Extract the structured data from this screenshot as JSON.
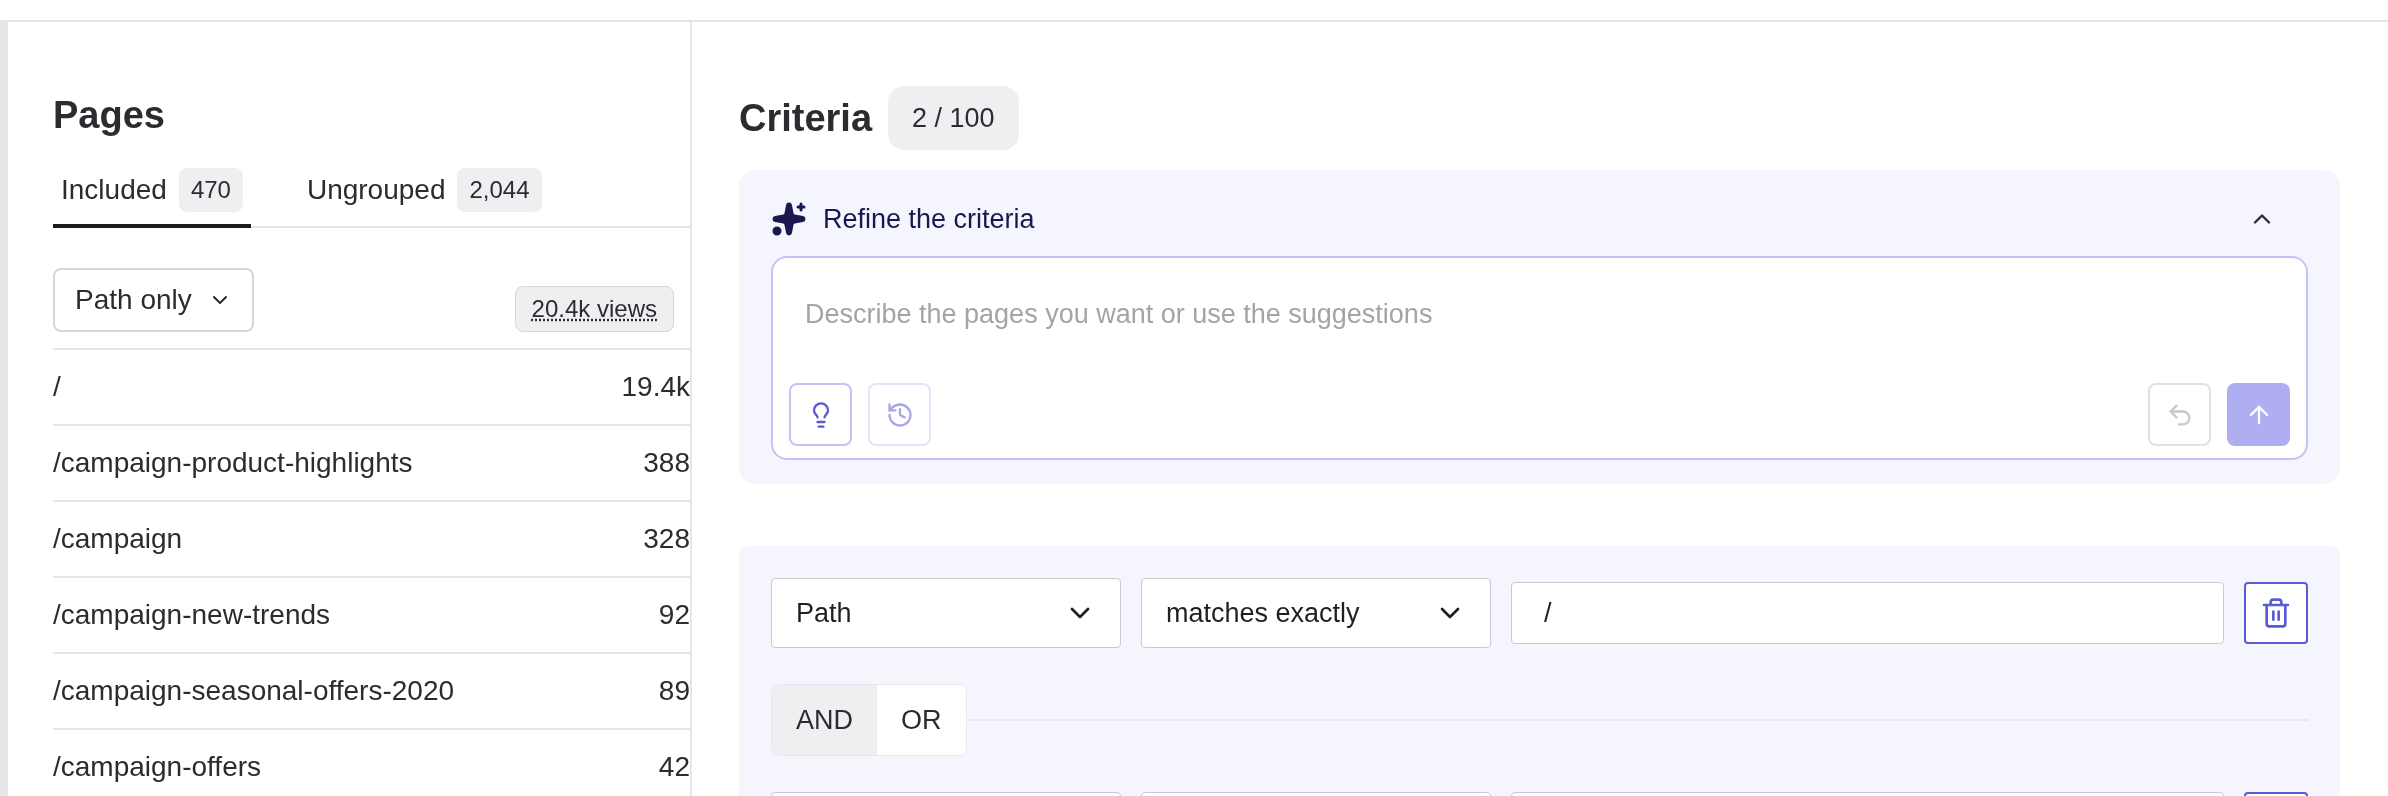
{
  "pages": {
    "title": "Pages",
    "tabs": [
      {
        "label": "Included",
        "count": "470",
        "selected": true
      },
      {
        "label": "Ungrouped",
        "count": "2,044",
        "selected": false
      }
    ],
    "filter": "Path only",
    "views": "20.4k views",
    "rows": [
      {
        "path": "/",
        "views": "19.4k"
      },
      {
        "path": "/campaign-product-highlights",
        "views": "388"
      },
      {
        "path": "/campaign",
        "views": "328"
      },
      {
        "path": "/campaign-new-trends",
        "views": "92"
      },
      {
        "path": "/campaign-seasonal-offers-2020",
        "views": "89"
      },
      {
        "path": "/campaign-offers",
        "views": "42"
      }
    ]
  },
  "criteria": {
    "title": "Criteria",
    "count": "2 / 100",
    "refine": {
      "title": "Refine the criteria",
      "expanded": true,
      "placeholder": "Describe the pages you want or use the suggestions"
    },
    "conditions": [
      {
        "kind": "full",
        "field": "Path",
        "operator": "matches exactly",
        "value": "/"
      },
      {
        "kind": "cut"
      }
    ],
    "logic": [
      {
        "label": "AND",
        "selected": true
      },
      {
        "label": "OR",
        "selected": false
      }
    ]
  }
}
